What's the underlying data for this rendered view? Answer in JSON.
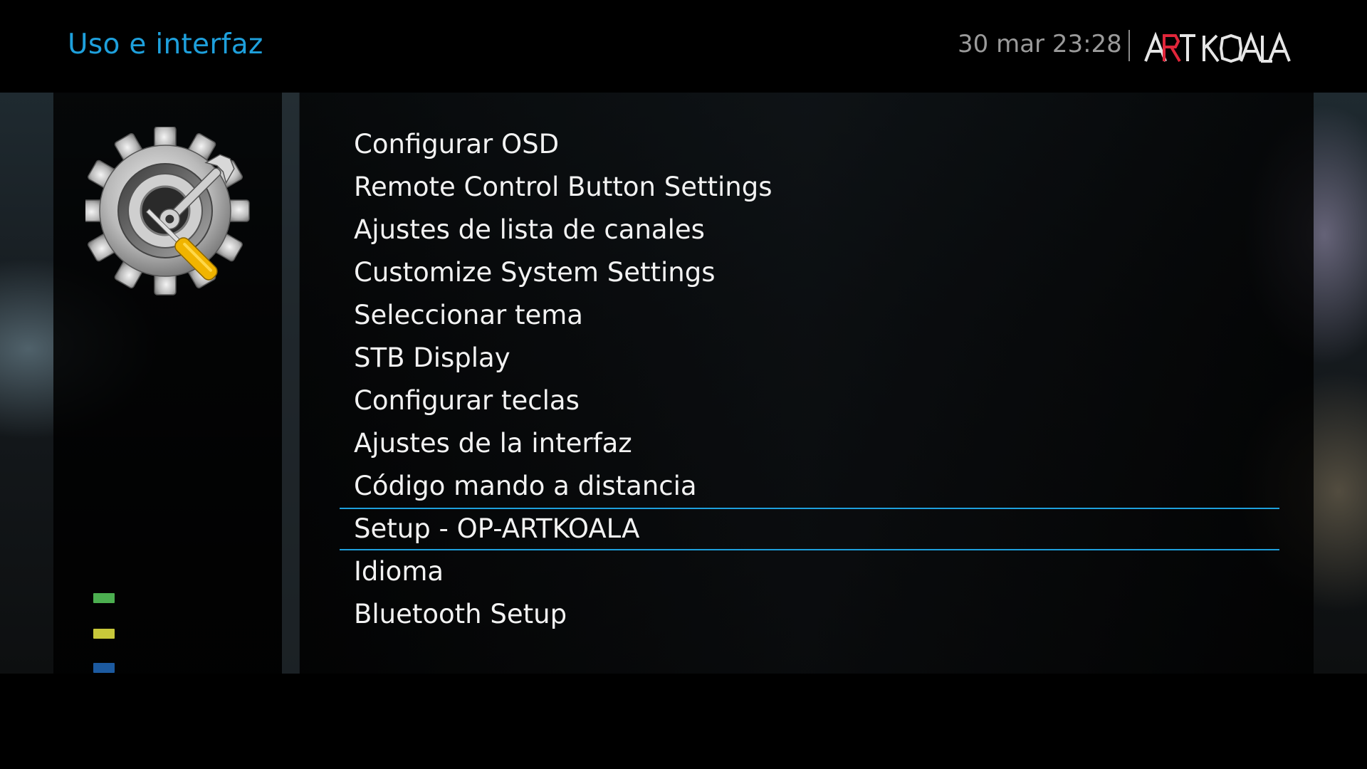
{
  "header": {
    "title": "Uso e interfaz",
    "datetime": "30 mar 23:28",
    "logo_text": "ARTKOALA"
  },
  "icons": {
    "gear": "settings-gear-wrench-icon"
  },
  "menu": {
    "items": [
      {
        "label": "Configurar OSD"
      },
      {
        "label": "Remote Control Button Settings"
      },
      {
        "label": "Ajustes de lista de canales"
      },
      {
        "label": "Customize System Settings"
      },
      {
        "label": "Seleccionar tema"
      },
      {
        "label": "STB Display"
      },
      {
        "label": "Configurar teclas"
      },
      {
        "label": "Ajustes de la interfaz"
      },
      {
        "label": "Código mando a distancia"
      },
      {
        "label": "Setup - OP-ARTKOALA",
        "selected": true
      },
      {
        "label": "Idioma"
      },
      {
        "label": "Bluetooth Setup"
      }
    ],
    "selected_index": 9
  },
  "color_keys": [
    {
      "name": "green",
      "color": "#4caf50"
    },
    {
      "name": "yellow",
      "color": "#c8c83a"
    },
    {
      "name": "blue",
      "color": "#1c5aa0"
    }
  ],
  "colors": {
    "accent": "#1ea0dc",
    "text": "#f2f2f2",
    "datetime": "#9a9a9a",
    "logo_red": "#e0263a"
  }
}
